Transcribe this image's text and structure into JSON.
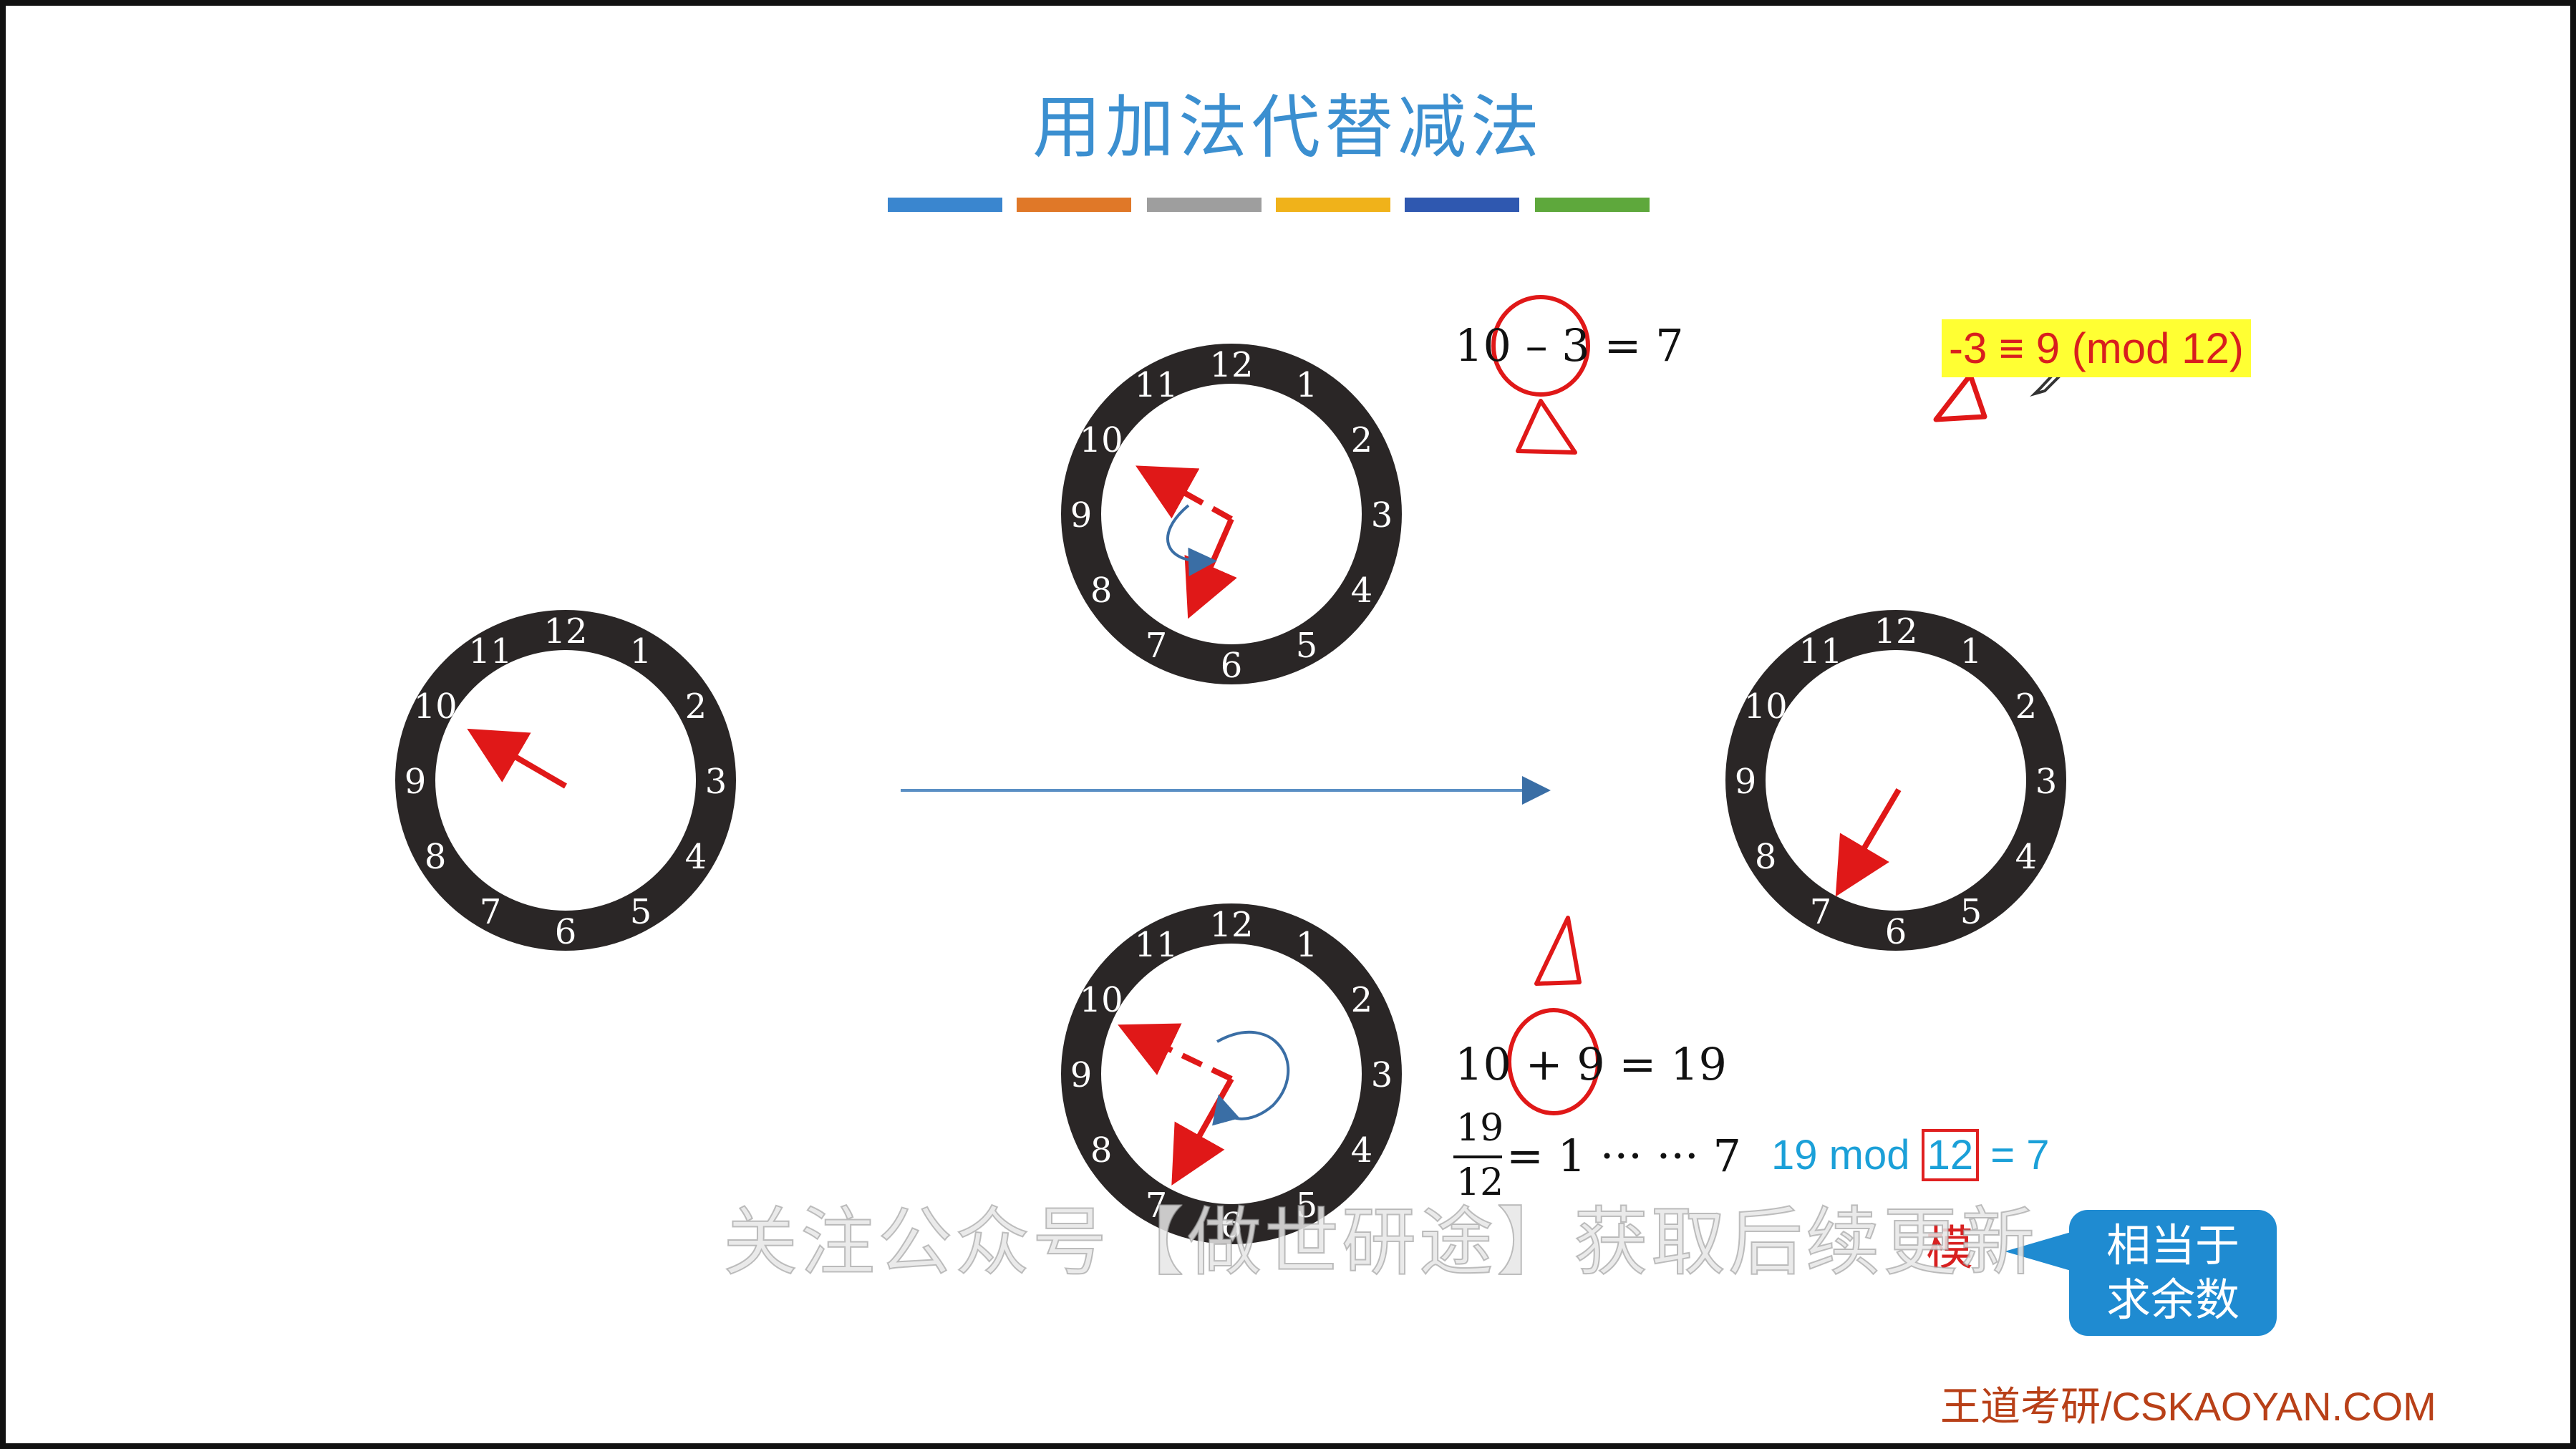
{
  "slide": {
    "title": "用加法代替减法",
    "color_bars": [
      "#3a86cf",
      "#e07828",
      "#9e9e9e",
      "#f0b21a",
      "#2f58b0",
      "#5ea83c"
    ]
  },
  "clock": {
    "numbers": [
      "12",
      "1",
      "2",
      "3",
      "4",
      "5",
      "6",
      "7",
      "8",
      "9",
      "10",
      "11"
    ]
  },
  "equations": {
    "subtraction": "10 – 3 = 7",
    "addition": "10 + 9 = 19",
    "fraction_numerator": "19",
    "fraction_denominator": "12",
    "division_result": "= 1 ··· ··· 7",
    "congruence": "-3 ≡ 9 (mod 12)",
    "mod_prefix": "19 mod",
    "mod_value": "12",
    "mod_suffix": "= 7"
  },
  "annotations": {
    "mo_label": "模",
    "callout_line1": "相当于",
    "callout_line2": "求余数"
  },
  "overlay": {
    "subtitle": "关注公众号【做世研途】获取后续更新",
    "watermark": "王道考研/CSKAOYAN.COM"
  }
}
